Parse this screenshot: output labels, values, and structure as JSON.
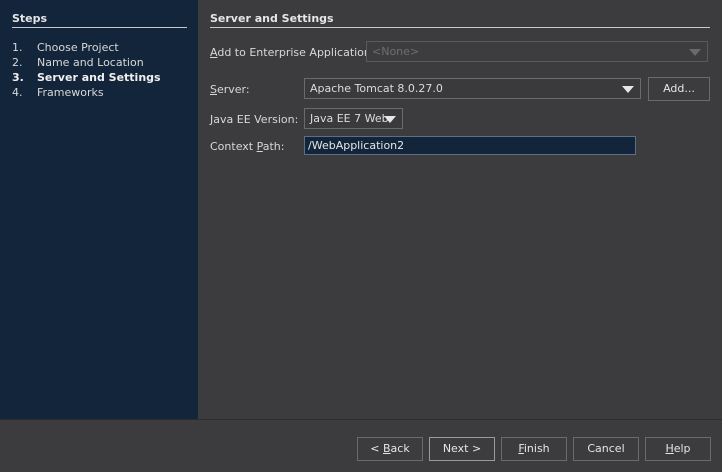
{
  "steps": {
    "title": "Steps",
    "items": [
      {
        "num": "1.",
        "label": "Choose Project"
      },
      {
        "num": "2.",
        "label": "Name and Location"
      },
      {
        "num": "3.",
        "label": "Server and Settings"
      },
      {
        "num": "4.",
        "label": "Frameworks"
      }
    ],
    "current_index": 2
  },
  "panel": {
    "title": "Server and Settings",
    "enterprise_app": {
      "label_mnemonic": "A",
      "label_rest": "dd to Enterprise Application:",
      "value": "<None>",
      "enabled": false
    },
    "server": {
      "label_mnemonic": "S",
      "label_rest": "erver:",
      "value": "Apache Tomcat 8.0.27.0",
      "add_button": "Add..."
    },
    "java_ee": {
      "label_mnemonic": "J",
      "label_rest": "ava EE Version:",
      "value": "Java EE 7 Web"
    },
    "context_path": {
      "label_pre": "Context ",
      "label_mnemonic": "P",
      "label_rest": "ath:",
      "value": "/WebApplication2"
    }
  },
  "footer": {
    "back_pre": "< ",
    "back_mnemonic": "B",
    "back_rest": "ack",
    "next": "Next >",
    "finish_mnemonic": "F",
    "finish_rest": "inish",
    "cancel": "Cancel",
    "help_mnemonic": "H",
    "help_rest": "elp"
  }
}
